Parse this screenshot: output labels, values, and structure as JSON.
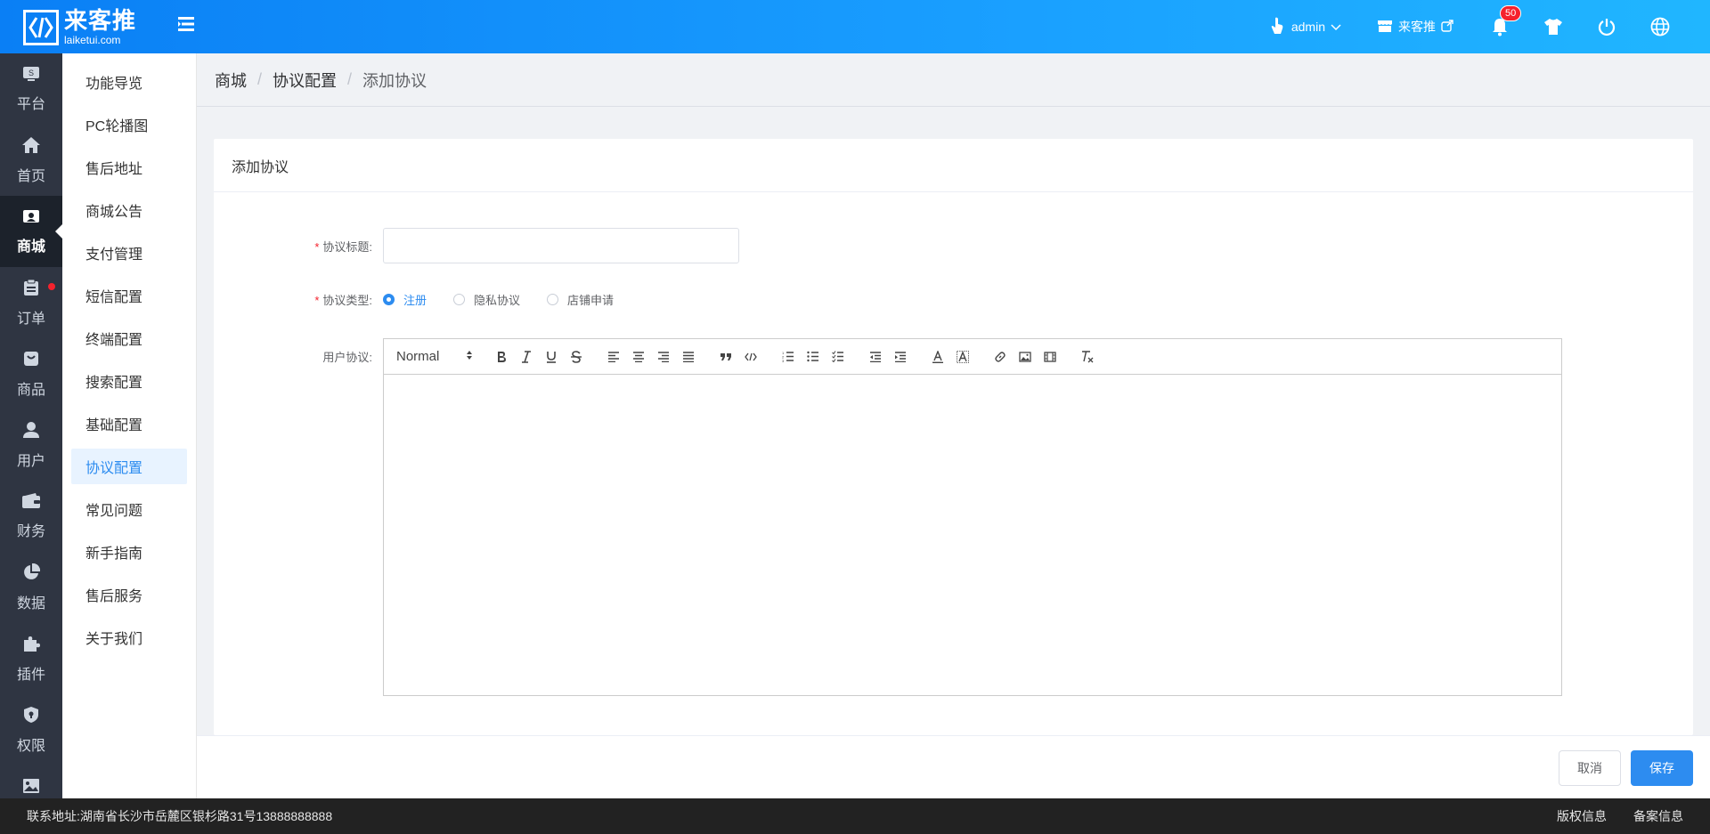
{
  "header": {
    "logo_cn": "来客推",
    "logo_en": "laiketui.com",
    "user_name": "admin",
    "shop_name": "来客推",
    "notification_count": "50"
  },
  "rail": {
    "items": [
      {
        "label": "平台",
        "icon": "platform-icon"
      },
      {
        "label": "首页",
        "icon": "home-icon"
      },
      {
        "label": "商城",
        "icon": "mall-icon"
      },
      {
        "label": "订单",
        "icon": "order-icon"
      },
      {
        "label": "商品",
        "icon": "product-icon"
      },
      {
        "label": "用户",
        "icon": "user-icon"
      },
      {
        "label": "财务",
        "icon": "wallet-icon"
      },
      {
        "label": "数据",
        "icon": "chart-icon"
      },
      {
        "label": "插件",
        "icon": "puzzle-icon"
      },
      {
        "label": "权限",
        "icon": "shield-icon"
      },
      {
        "label": "",
        "icon": "image-icon"
      }
    ]
  },
  "submenu": {
    "items": [
      "功能导览",
      "PC轮播图",
      "售后地址",
      "商城公告",
      "支付管理",
      "短信配置",
      "终端配置",
      "搜索配置",
      "基础配置",
      "协议配置",
      "常见问题",
      "新手指南",
      "售后服务",
      "关于我们"
    ],
    "active": "协议配置"
  },
  "breadcrumb": {
    "level1": "商城",
    "level2": "协议配置",
    "level3": "添加协议",
    "separator": "/"
  },
  "card": {
    "title": "添加协议"
  },
  "form": {
    "title_label": "协议标题:",
    "title_value": "",
    "type_label": "协议类型:",
    "type_options": [
      "注册",
      "隐私协议",
      "店铺申请"
    ],
    "type_selected": "注册",
    "content_label": "用户协议:",
    "required_mark": "*"
  },
  "editor": {
    "format_select": "Normal"
  },
  "actions": {
    "cancel": "取消",
    "save": "保存"
  },
  "footer": {
    "address": "联系地址:湖南省长沙市岳麓区银杉路31号13888888888",
    "copyright": "版权信息",
    "icp": "备案信息"
  },
  "colors": {
    "primary": "#2d8cf0",
    "header_start": "#0a7ff5",
    "header_end": "#20b6ff",
    "rail_bg": "#2f3542"
  }
}
